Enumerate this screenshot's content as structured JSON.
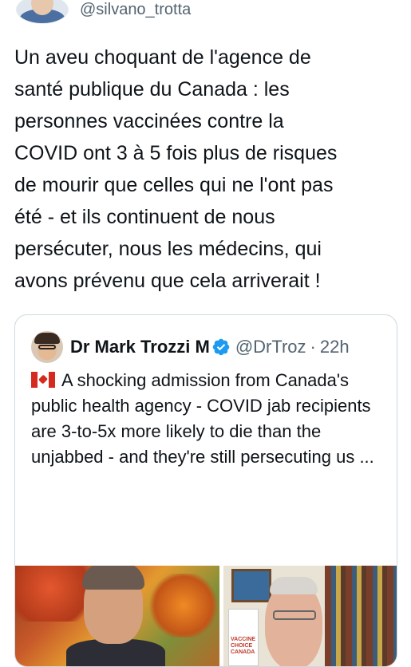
{
  "author": {
    "handle": "@silvano_trotta"
  },
  "tweet": {
    "text": "Un aveu choquant de l'agence de\nsanté publique du Canada : les\npersonnes vaccinées contre la\nCOVID ont 3 à 5 fois plus de risques\nde mourir que celles qui ne l'ont pas\nété - et ils continuent de nous\npersécuter, nous les médecins, qui\navons prévenu que cela arriverait !"
  },
  "quote": {
    "name": "Dr Mark Trozzi M",
    "handle": "@DrTroz",
    "separator": "·",
    "time": "22h",
    "text": "A shocking admission from Canada's public health agency - COVID jab recipients are 3-to-5x more likely to die than the unjabbed - and they're still persecuting us ...",
    "flag_icon": "canada-flag-icon",
    "media_sign_text": "VACCINE CHOICE CANADA"
  },
  "colors": {
    "text": "#0f1419",
    "secondary": "#536471",
    "border": "#cfd9de",
    "verified": "#1d9bf0"
  }
}
